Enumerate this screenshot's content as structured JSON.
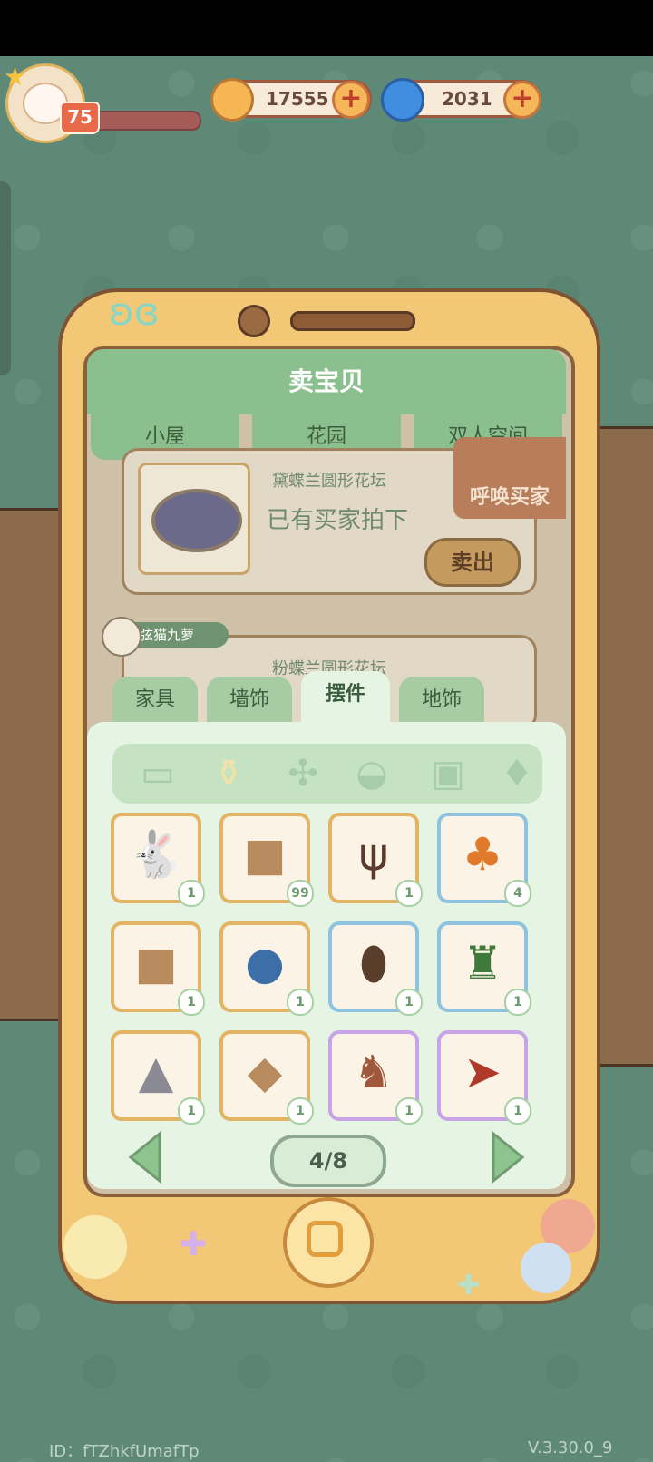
{
  "hud": {
    "level": "75",
    "coins": "17555",
    "gems": "2031"
  },
  "phone": {
    "title": "卖宝贝",
    "top_tabs": [
      "小屋",
      "花园",
      "双人空间"
    ],
    "listings": [
      {
        "name": "黛蝶兰圆形花坛",
        "status": "已有买家拍下",
        "action": "卖出"
      },
      {
        "seller": "弦猫九萝",
        "name": "粉蝶兰圆形花坛"
      }
    ],
    "summon_label": "呼唤买家",
    "category_tabs": [
      "家具",
      "墙饰",
      "摆件",
      "地饰"
    ],
    "active_category": "摆件",
    "sub_categories": [
      "pillow-icon",
      "vase-icon",
      "fan-icon",
      "pet-bowl-icon",
      "toilet-paper-icon",
      "playing-card-icon"
    ],
    "items": [
      {
        "name": "rabbit-plush-icon",
        "count": "1",
        "frame": "gold"
      },
      {
        "name": "cardboard-box-icon",
        "count": "99",
        "frame": "gold"
      },
      {
        "name": "antler-ornament-icon",
        "count": "1",
        "frame": "gold"
      },
      {
        "name": "orange-bonsai-icon",
        "count": "4",
        "frame": "blue"
      },
      {
        "name": "cardboard-box-icon",
        "count": "1",
        "frame": "gold"
      },
      {
        "name": "globe-icon",
        "count": "1",
        "frame": "gold"
      },
      {
        "name": "coin-jar-icon",
        "count": "1",
        "frame": "blue"
      },
      {
        "name": "top-hat-plant-icon",
        "count": "1",
        "frame": "blue"
      },
      {
        "name": "mountain-model-icon",
        "count": "1",
        "frame": "gold"
      },
      {
        "name": "cardboard-box-icon",
        "count": "1",
        "frame": "gold"
      },
      {
        "name": "cat-figurine-icon",
        "count": "1",
        "frame": "purple"
      },
      {
        "name": "red-sled-icon",
        "count": "1",
        "frame": "purple"
      }
    ],
    "page_indicator": "4/8"
  },
  "footer": {
    "id_text": "ID：fTZhkfUmafTp",
    "version": "V.3.30.0_9"
  },
  "colors": {
    "background": "#5e8977",
    "phone_body": "#f2c877",
    "panel_green": "#8bbf8e",
    "inventory_bg": "#e6f4e4"
  }
}
